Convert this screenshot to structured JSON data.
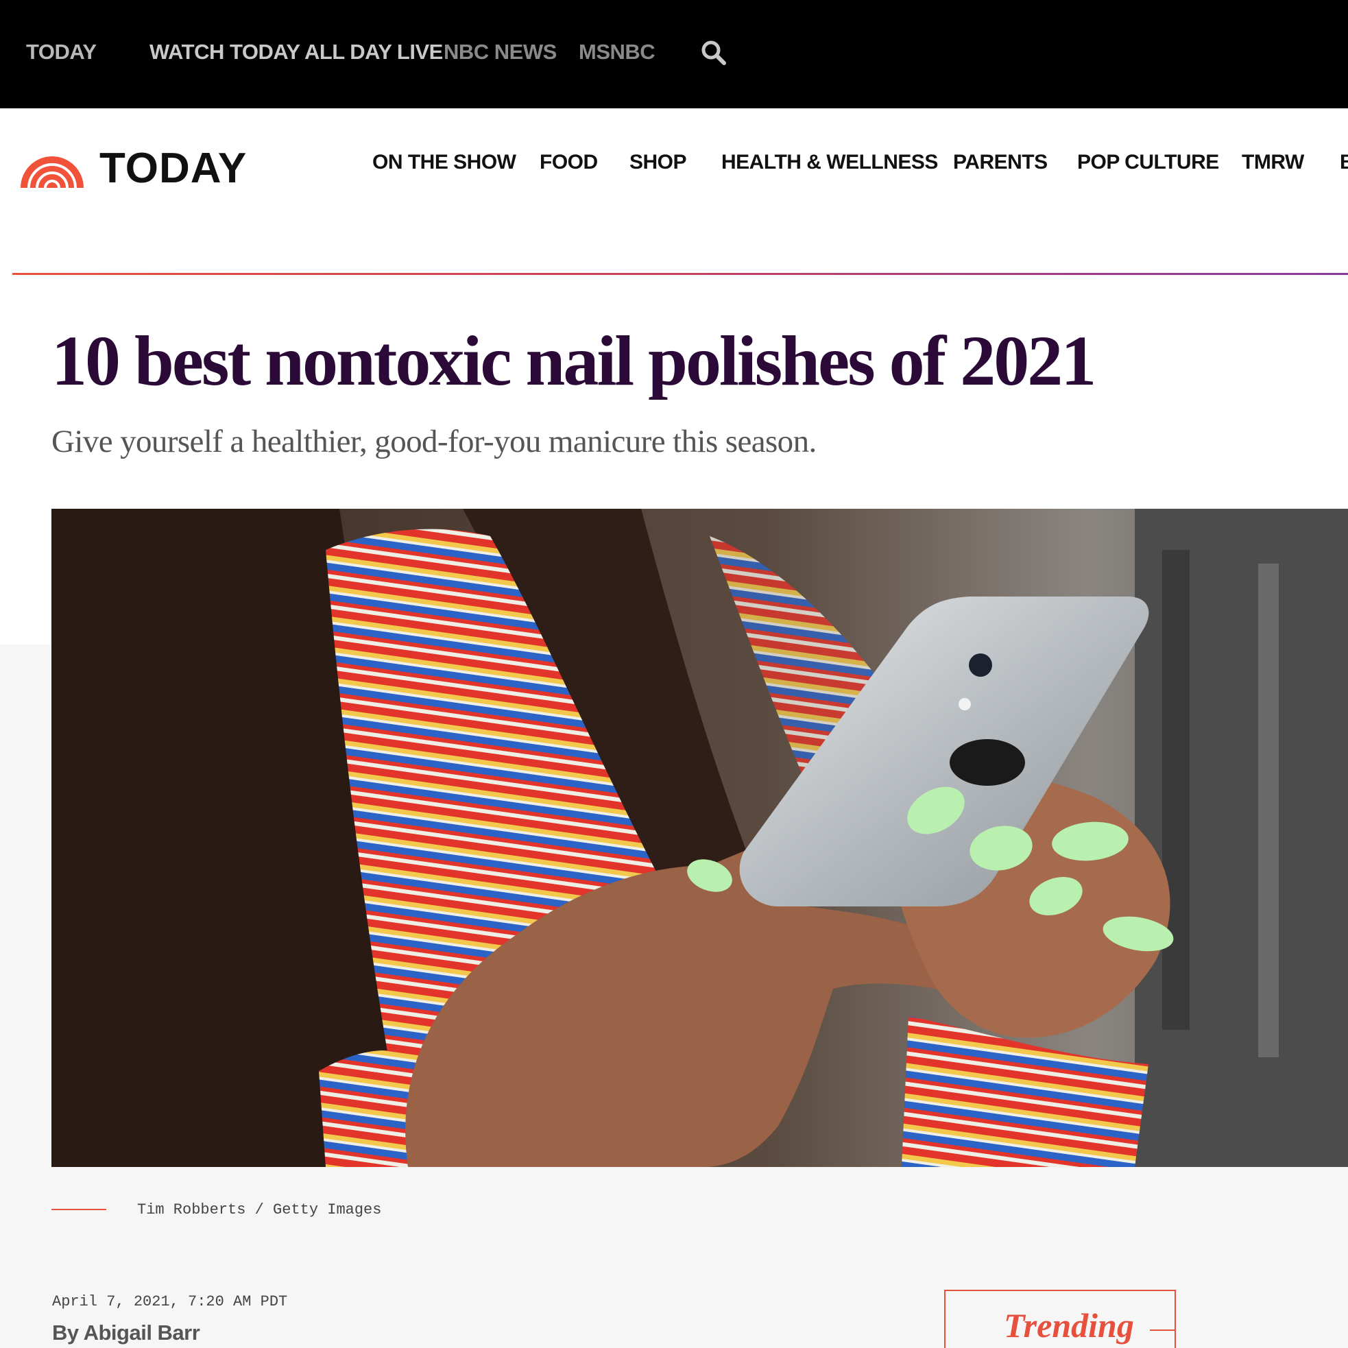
{
  "top_bar": {
    "links": [
      "TODAY",
      "WATCH TODAY ALL DAY LIVE",
      "NBC NEWS",
      "MSNBC"
    ],
    "search_icon": "search-icon"
  },
  "main_nav": {
    "logo_text": "TODAY",
    "items": [
      "ON THE SHOW",
      "FOOD",
      "SHOP",
      "HEALTH & WELLNESS",
      "PARENTS",
      "POP CULTURE",
      "TMRW",
      "B"
    ]
  },
  "article": {
    "headline": "10 best nontoxic nail polishes of 2021",
    "dek": "Give yourself a healthier, good-for-you manicure this season.",
    "image_caption": "Tim Robberts / Getty Images",
    "date": "April 7, 2021, 7:20 AM PDT",
    "byline": "By Abigail Barr"
  },
  "sidebar": {
    "trending_label": "Trending"
  },
  "colors": {
    "brand_orange": "#e6503c",
    "headline_purple": "#2b0a38",
    "gradient_end": "#8a37a3"
  }
}
